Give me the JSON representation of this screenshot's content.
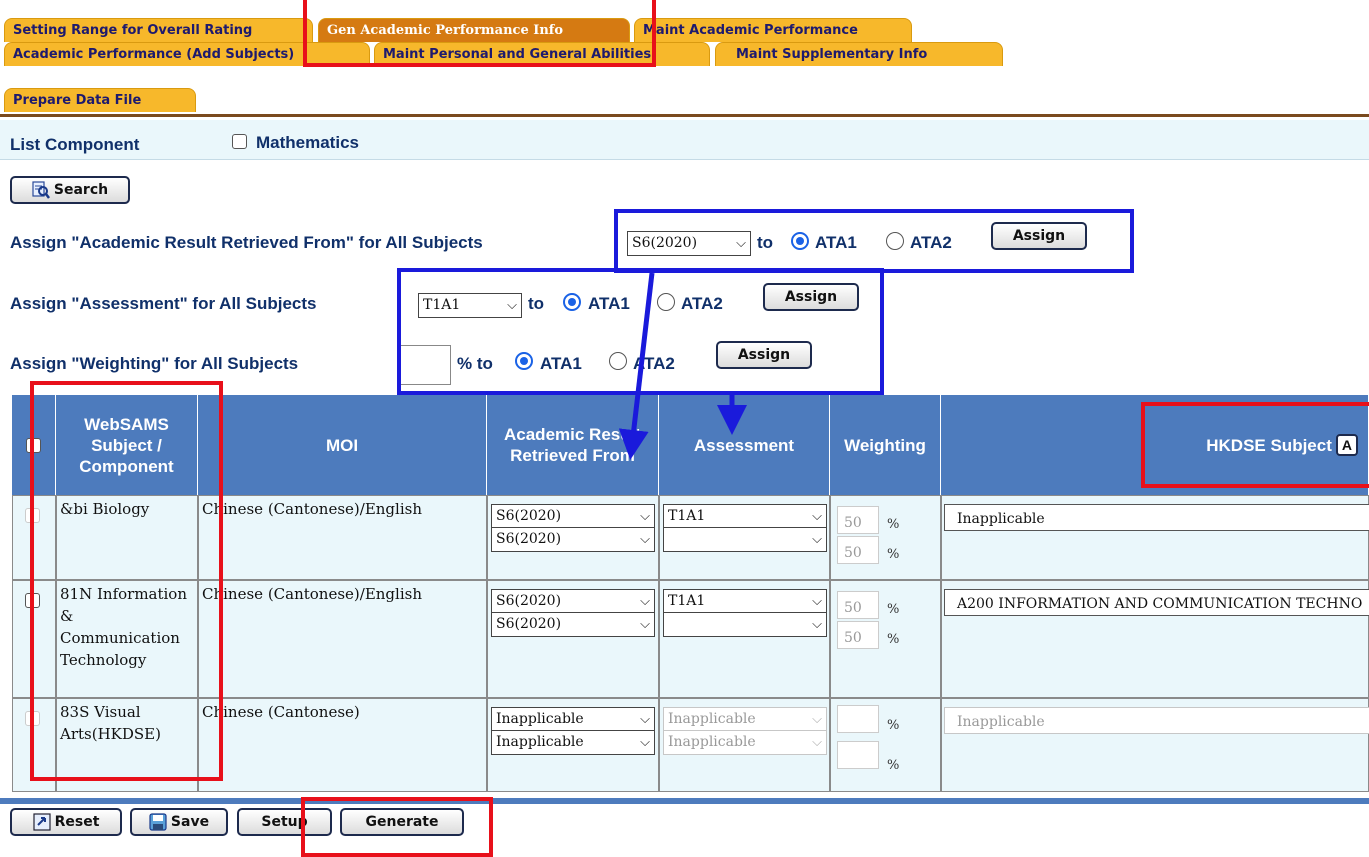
{
  "tabs": [
    "Setting Range for Overall Rating",
    "Gen Academic Performance Info",
    "Maint Academic Performance",
    "Academic Performance (Add Subjects)",
    "Maint Personal and General Abilities",
    "Maint Supplementary Info",
    "Prepare Data File"
  ],
  "list_component": {
    "label": "List Component",
    "checkbox_label": "Mathematics",
    "checked": false
  },
  "search_button": "Search",
  "assign_rows": {
    "academic": {
      "label": "Assign \"Academic Result Retrieved From\" for All Subjects",
      "select_value": "S6(2020)",
      "to": "to",
      "radio1": "ATA1",
      "radio2": "ATA2",
      "button": "Assign"
    },
    "assessment": {
      "label": "Assign \"Assessment\" for All Subjects",
      "select_value": "T1A1",
      "to": "to",
      "radio1": "ATA1",
      "radio2": "ATA2",
      "button": "Assign"
    },
    "weighting": {
      "label": "Assign \"Weighting\" for All Subjects",
      "input_value": "",
      "suffix": "% to",
      "radio1": "ATA1",
      "radio2": "ATA2",
      "button": "Assign"
    }
  },
  "table": {
    "headers": {
      "subject": "WebSAMS Subject / Component",
      "moi": "MOI",
      "academic": "Academic Result Retrieved From",
      "assessment": "Assessment",
      "weighting": "Weighting",
      "hkdse": "HKDSE Subject",
      "hkdse_btn": "A"
    },
    "rows": [
      {
        "subject": "&bi Biology",
        "moi": "Chinese (Cantonese)/English",
        "academic1": "S6(2020)",
        "academic2": "S6(2020)",
        "assessment1": "T1A1",
        "assessment2": "",
        "weight1": "50",
        "weight2": "50",
        "pct": "%",
        "hkdse": "Inapplicable"
      },
      {
        "subject": "81N Information & Communication Technology",
        "moi": "Chinese (Cantonese)/English",
        "academic1": "S6(2020)",
        "academic2": "S6(2020)",
        "assessment1": "T1A1",
        "assessment2": "",
        "weight1": "50",
        "weight2": "50",
        "pct": "%",
        "hkdse": "A200 INFORMATION AND COMMUNICATION TECHNO"
      },
      {
        "subject": "83S Visual Arts(HKDSE)",
        "moi": "Chinese (Cantonese)",
        "academic1": "Inapplicable",
        "academic2": "Inapplicable",
        "assessment1": "Inapplicable",
        "assessment2": "Inapplicable",
        "weight1": "",
        "weight2": "",
        "pct": "%",
        "hkdse": "Inapplicable"
      }
    ]
  },
  "bottom_buttons": {
    "reset": "Reset",
    "save": "Save",
    "setup": "Setup",
    "generate": "Generate"
  },
  "colors": {
    "tab": "#f7b82b",
    "tab_active": "#d57a12",
    "header": "#4d7bbd",
    "row_bg": "#eaf7fb",
    "annotation_red": "#e8101a",
    "annotation_blue": "#1a1adb"
  }
}
